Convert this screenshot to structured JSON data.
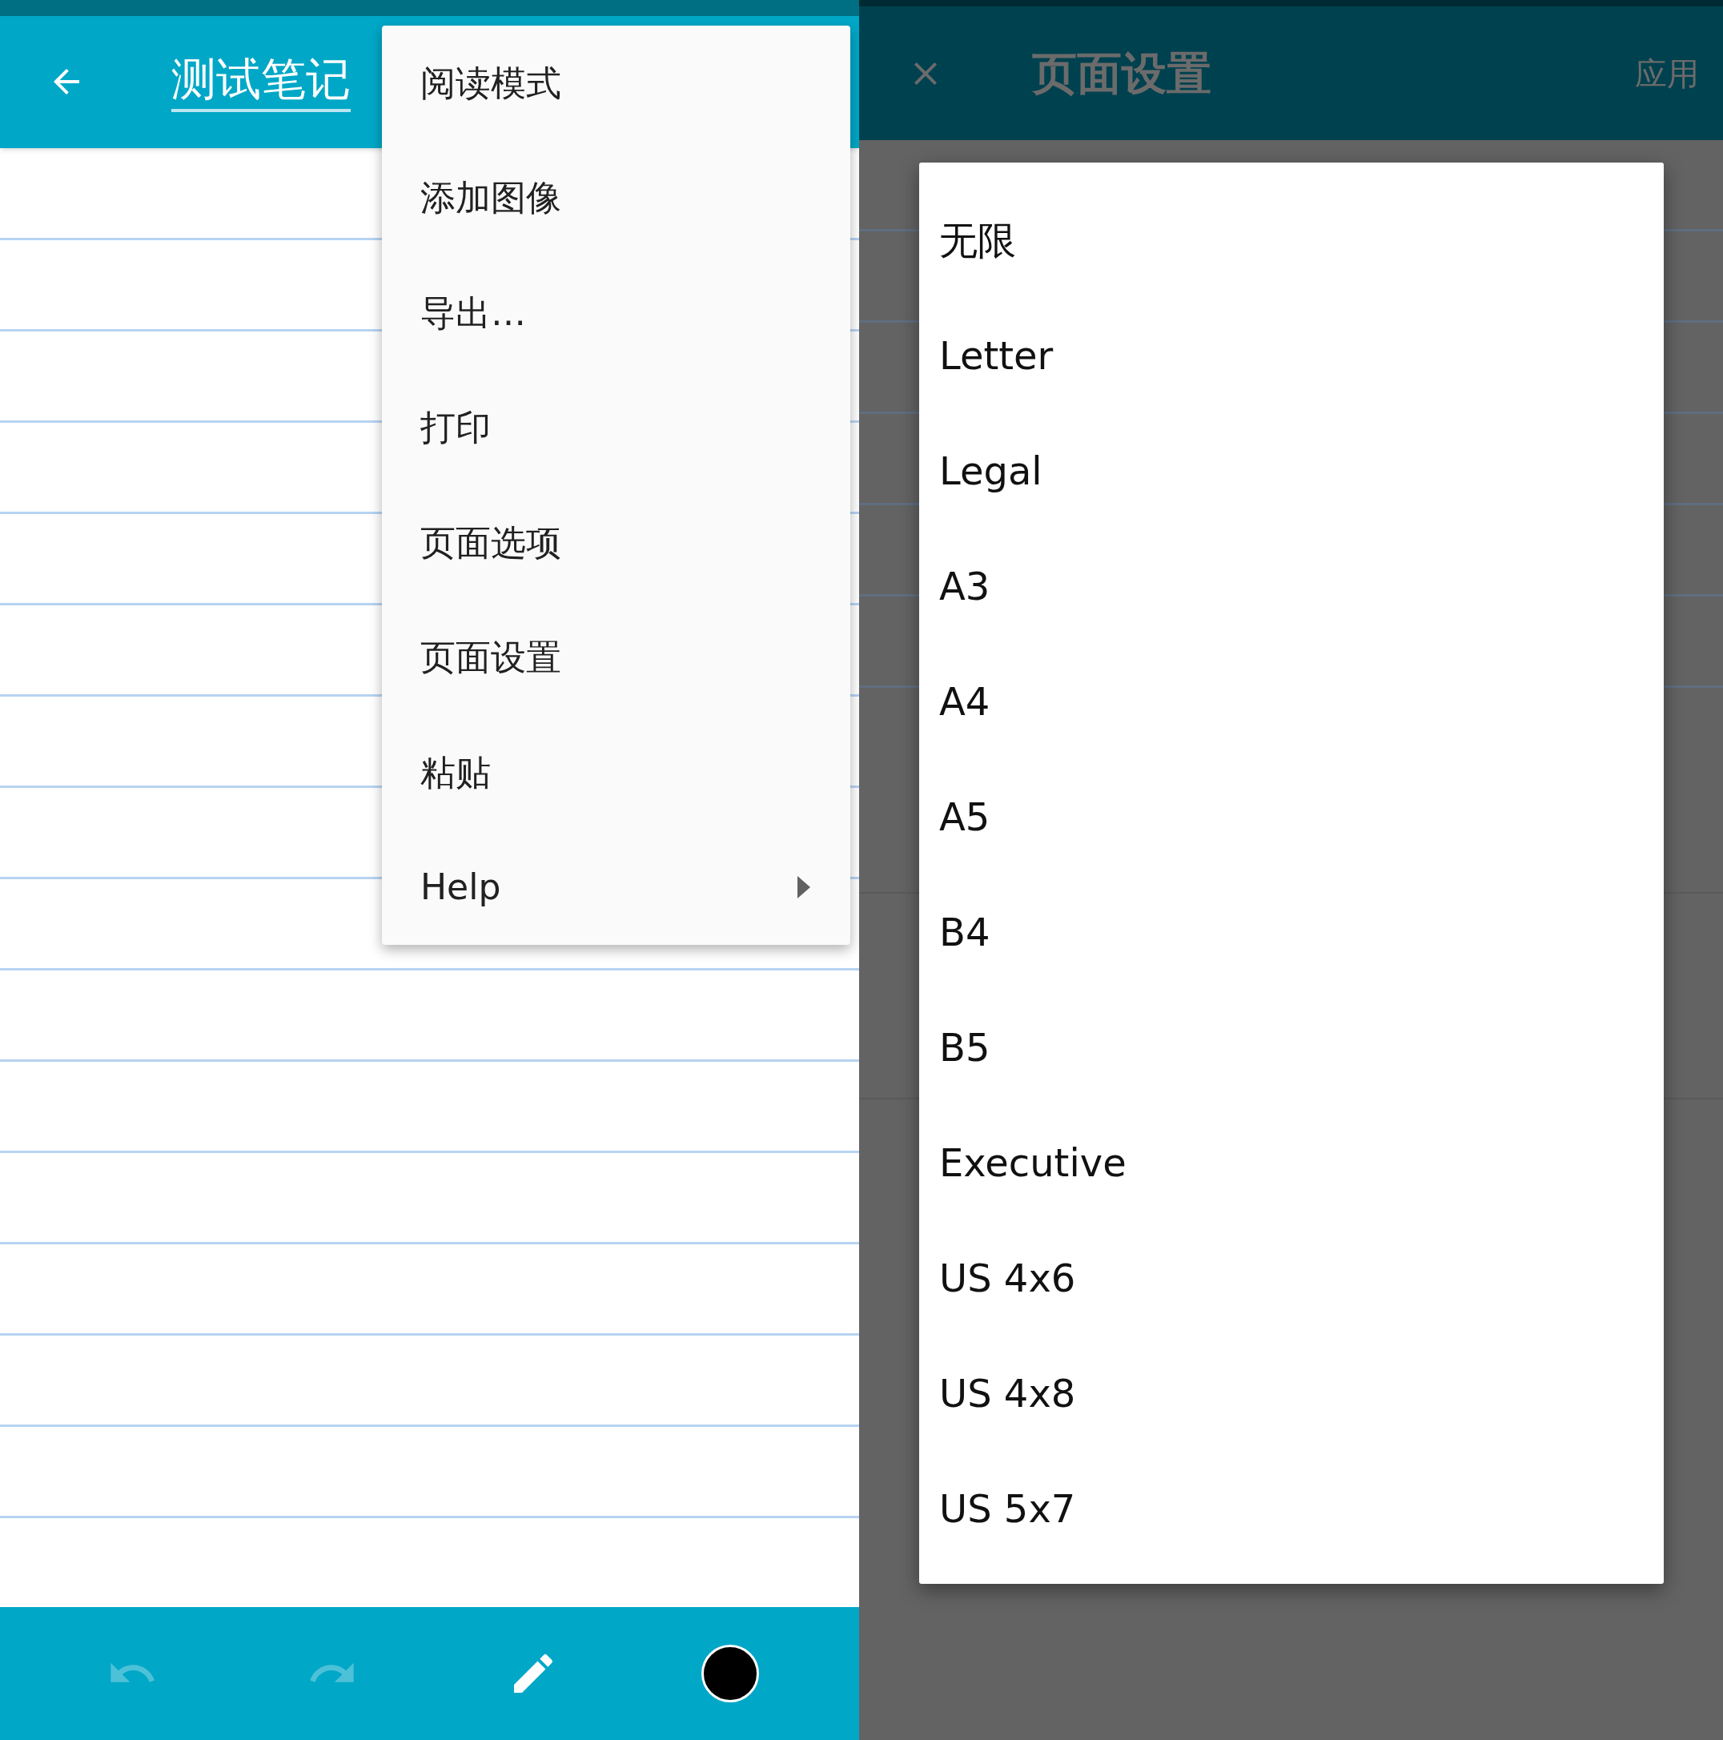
{
  "note_screen": {
    "title": "测试笔记",
    "menu": [
      {
        "label": "阅读模式",
        "has_submenu": false
      },
      {
        "label": "添加图像",
        "has_submenu": false
      },
      {
        "label": "导出…",
        "has_submenu": false
      },
      {
        "label": "打印",
        "has_submenu": false
      },
      {
        "label": "页面选项",
        "has_submenu": false
      },
      {
        "label": "页面设置",
        "has_submenu": false
      },
      {
        "label": "粘贴",
        "has_submenu": false
      },
      {
        "label": "Help",
        "has_submenu": true
      }
    ],
    "bottom_bar": {
      "undo": {
        "disabled": true
      },
      "redo": {
        "disabled": true
      },
      "pen": {
        "selected": true
      },
      "color_swatch": {
        "color": "#000000"
      }
    }
  },
  "page_setup_screen": {
    "title": "页面设置",
    "apply_button": "应用",
    "size_options": [
      {
        "label": "无限"
      },
      {
        "label": "Letter"
      },
      {
        "label": "Legal"
      },
      {
        "label": "A3"
      },
      {
        "label": "A4"
      },
      {
        "label": "A5"
      },
      {
        "label": "B4"
      },
      {
        "label": "B5"
      },
      {
        "label": "Executive"
      },
      {
        "label": "US 4x6"
      },
      {
        "label": "US 4x8"
      },
      {
        "label": "US 5x7"
      }
    ]
  }
}
